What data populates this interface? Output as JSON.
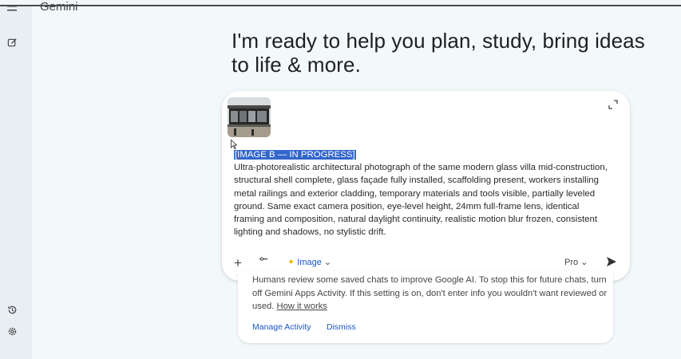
{
  "app": {
    "name": "Gemini"
  },
  "headline": "I'm ready to help you plan, study, bring ideas to life & more.",
  "composer": {
    "attachment_icon": "image-thumbnail",
    "selected_label": "[IMAGE B — IN PROGRESS]",
    "prompt_text": "Ultra-photorealistic architectural photograph of the same modern glass villa mid-construction, structural shell complete, glass façade fully installed, scaffolding present, workers installing metal railings and exterior cladding, temporary materials and tools visible, partially leveled ground. Same exact camera position, eye-level height, 24mm full-frame lens, identical framing and composition, natural daylight continuity, realistic motion blur frozen, consistent lighting and shadows, no stylistic drift.",
    "tools": {
      "image_label": "Image",
      "mode_label": "Pro"
    }
  },
  "notice": {
    "text": "Humans review some saved chats to improve Google AI. To stop this for future chats, turn off Gemini Apps Activity. If this setting is on, don't enter info you wouldn't want reviewed or used.",
    "link": "How it works",
    "manage_label": "Manage Activity",
    "dismiss_label": "Dismiss"
  },
  "colors": {
    "selection": "#3366cc",
    "accent": "#1a56c7",
    "background": "#f1f6f9"
  }
}
